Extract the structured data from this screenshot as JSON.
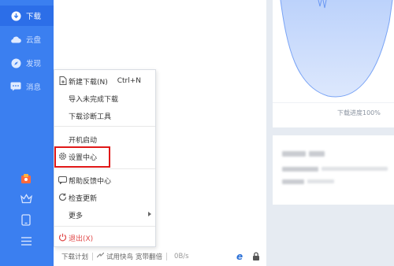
{
  "sidebar": {
    "items": [
      {
        "label": "下载",
        "icon": "download-icon"
      },
      {
        "label": "云盘",
        "icon": "cloud-icon"
      },
      {
        "label": "发现",
        "icon": "compass-icon"
      },
      {
        "label": "消息",
        "icon": "chat-icon"
      }
    ],
    "tools": [
      "gift-icon",
      "crown-icon",
      "tablet-icon",
      "menu-icon"
    ]
  },
  "menu": {
    "items": [
      {
        "label": "新建下载(N)",
        "shortcut": "Ctrl+N"
      },
      {
        "label": "导入未完成下载"
      },
      {
        "label": "下载诊断工具"
      },
      {
        "label": "开机启动"
      },
      {
        "label": "设置中心"
      },
      {
        "label": "帮助反馈中心"
      },
      {
        "label": "检查更新"
      },
      {
        "label": "更多"
      },
      {
        "label": "退出(X)"
      }
    ]
  },
  "status": {
    "plan": "下载计划",
    "kuainiao": "试用快鸟",
    "bandwidth": "宽带翻倍",
    "speed": "0B/s"
  },
  "card": {
    "progress": "下载进度100%"
  },
  "colors": {
    "sidebar": "#3b7ff0",
    "accent": "#2c6ee8",
    "highlight": "#e01818"
  }
}
